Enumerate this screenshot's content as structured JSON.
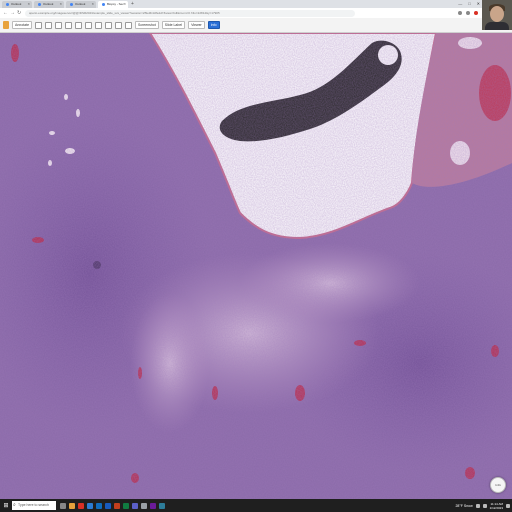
{
  "browser": {
    "tabs": [
      {
        "label": "Outlook"
      },
      {
        "label": "Outlook"
      },
      {
        "label": "Outlook"
      },
      {
        "label": "Biopsy - Sec"
      }
    ],
    "url": "aperio.example.org/imageserver/@@/DSR2023/example_slide_svs_viewer?session=2f9e3b4c8a1d7&view=full&zoom=0.7&x=22814&y=17905",
    "window_controls": [
      "—",
      "□",
      "✕"
    ]
  },
  "viewer": {
    "toolbar": {
      "items": [
        "Annotate",
        "Screenshot",
        "Slide Label",
        "Viewer"
      ],
      "active": "Info"
    }
  },
  "slide": {
    "zoom_button_label": "1.0x"
  },
  "taskbar": {
    "search_placeholder": "Type here to search",
    "weather": "28°F Snow",
    "time": "11:14 AM",
    "date": "1/12/2023"
  },
  "colors": {
    "tissue": "#8a6aa8",
    "stroma": "#c9a9cf",
    "blood": "#c0203a",
    "marker": "#2a2a2a"
  }
}
